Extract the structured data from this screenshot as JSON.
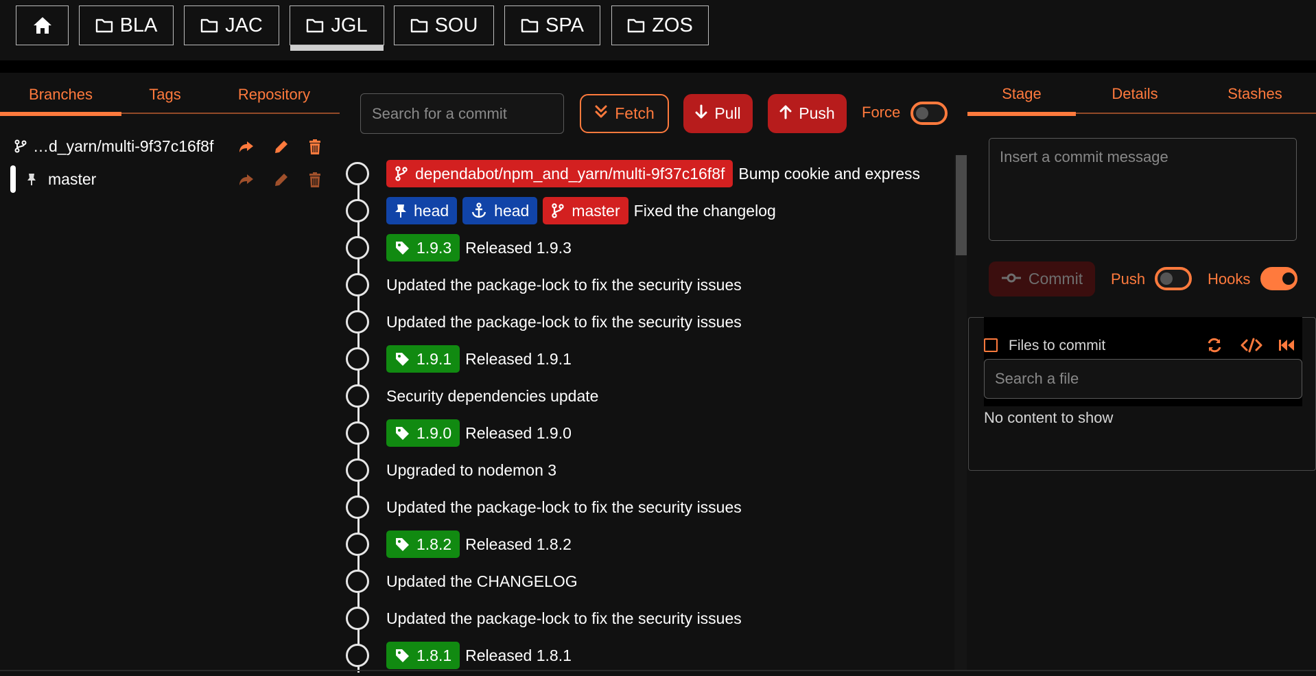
{
  "repo_tabs": [
    {
      "label": "",
      "icon": "home-icon"
    },
    {
      "label": "BLA",
      "icon": "folder-icon"
    },
    {
      "label": "JAC",
      "icon": "folder-icon"
    },
    {
      "label": "JGL",
      "icon": "folder-icon",
      "active": true
    },
    {
      "label": "SOU",
      "icon": "folder-icon"
    },
    {
      "label": "SPA",
      "icon": "folder-icon"
    },
    {
      "label": "ZOS",
      "icon": "folder-icon"
    }
  ],
  "left_panel": {
    "tabs": [
      "Branches",
      "Tags",
      "Repository"
    ],
    "active_tab": "Branches",
    "branches": [
      {
        "name": "…d_yarn/multi-9f37c16f8f",
        "icon": "branch-icon"
      },
      {
        "name": "master",
        "icon": "pin-icon",
        "active": true
      }
    ]
  },
  "toolbar": {
    "search_placeholder": "Search for a commit",
    "fetch_label": "Fetch",
    "pull_label": "Pull",
    "push_label": "Push",
    "force_label": "Force",
    "force_on": false
  },
  "commits": [
    {
      "refs": [
        {
          "type": "branch",
          "color": "red",
          "label": "dependabot/npm_and_yarn/multi-9f37c16f8f"
        }
      ],
      "message": "Bump cookie and express"
    },
    {
      "refs": [
        {
          "type": "pin",
          "color": "blue",
          "label": "head"
        },
        {
          "type": "anchor",
          "color": "blue",
          "label": "head"
        },
        {
          "type": "branch",
          "color": "red",
          "label": "master"
        }
      ],
      "message": "Fixed the changelog"
    },
    {
      "refs": [
        {
          "type": "tag",
          "color": "green",
          "label": "1.9.3"
        }
      ],
      "message": "Released 1.9.3"
    },
    {
      "refs": [],
      "message": "Updated the package-lock to fix the security issues"
    },
    {
      "refs": [],
      "message": "Updated the package-lock to fix the security issues"
    },
    {
      "refs": [
        {
          "type": "tag",
          "color": "green",
          "label": "1.9.1"
        }
      ],
      "message": "Released 1.9.1"
    },
    {
      "refs": [],
      "message": "Security dependencies update"
    },
    {
      "refs": [
        {
          "type": "tag",
          "color": "green",
          "label": "1.9.0"
        }
      ],
      "message": "Released 1.9.0"
    },
    {
      "refs": [],
      "message": "Upgraded to nodemon 3"
    },
    {
      "refs": [],
      "message": "Updated the package-lock to fix the security issues"
    },
    {
      "refs": [
        {
          "type": "tag",
          "color": "green",
          "label": "1.8.2"
        }
      ],
      "message": "Released 1.8.2"
    },
    {
      "refs": [],
      "message": "Updated the CHANGELOG"
    },
    {
      "refs": [],
      "message": "Updated the package-lock to fix the security issues"
    },
    {
      "refs": [
        {
          "type": "tag",
          "color": "green",
          "label": "1.8.1"
        }
      ],
      "message": "Released 1.8.1"
    }
  ],
  "right_panel": {
    "tabs": [
      "Stage",
      "Details",
      "Stashes"
    ],
    "active_tab": "Stage",
    "commit_placeholder": "Insert a commit message",
    "commit_label": "Commit",
    "push_label": "Push",
    "push_on": false,
    "hooks_label": "Hooks",
    "hooks_on": true,
    "files_title": "Files to commit",
    "file_search_placeholder": "Search a file",
    "empty_text": "No content to show"
  },
  "colors": {
    "accent": "#ff7a3d",
    "ref_red": "#d32020",
    "ref_blue": "#1144a8",
    "ref_green": "#118a11",
    "background": "#111111"
  }
}
